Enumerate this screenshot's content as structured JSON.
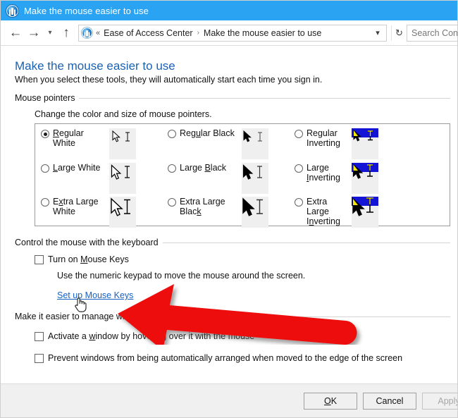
{
  "window": {
    "title": "Make the mouse easier to use",
    "title_icon": "ease-of-access-icon",
    "titlebar_color": "#29a3f2"
  },
  "navbar": {
    "back_icon": "back-arrow-icon",
    "forward_icon": "forward-arrow-icon",
    "history_icon": "chevron-down-icon",
    "up_icon": "up-arrow-icon",
    "address_icon": "ease-of-access-icon",
    "overflow_chevrons": "«",
    "breadcrumb": [
      {
        "label": "Ease of Access Center"
      },
      {
        "label": "Make the mouse easier to use"
      }
    ],
    "breadcrumb_separator": "›",
    "dropdown_icon": "chevron-down-icon",
    "refresh_icon": "refresh-icon",
    "refresh_glyph": "↻",
    "search_placeholder": "Search Contr"
  },
  "page": {
    "title": "Make the mouse easier to use",
    "title_color": "#1b61b0",
    "subtitle": "When you select these tools, they will automatically start each time you sign in."
  },
  "sections": {
    "mouse_pointers": {
      "heading": "Mouse pointers",
      "hint": "Change the color and size of mouse pointers.",
      "options": [
        {
          "id": "regular-white",
          "line1": "Regular",
          "line2": "White",
          "accel": "R",
          "selected": true,
          "style": "white"
        },
        {
          "id": "large-white",
          "line1": "Large White",
          "line2": "",
          "accel": "L",
          "selected": false,
          "style": "white"
        },
        {
          "id": "extra-large-white",
          "line1": "Extra Large",
          "line2": "White",
          "accel": "x",
          "selected": false,
          "style": "white"
        },
        {
          "id": "regular-black",
          "line1": "Regular Black",
          "line2": "",
          "accel": "u",
          "selected": false,
          "style": "black"
        },
        {
          "id": "large-black",
          "line1": "Large Black",
          "line2": "",
          "accel": "B",
          "selected": false,
          "style": "black"
        },
        {
          "id": "extra-large-black",
          "line1": "Extra Large",
          "line2": "Black",
          "accel": "k",
          "selected": false,
          "style": "black"
        },
        {
          "id": "regular-inverting",
          "line1": "Regular",
          "line2": "Inverting",
          "accel": "",
          "selected": false,
          "style": "inverting"
        },
        {
          "id": "large-inverting",
          "line1": "Large",
          "line2": "Inverting",
          "accel": "I",
          "selected": false,
          "style": "inverting"
        },
        {
          "id": "extra-large-inverting",
          "line1": "Extra Large",
          "line2": "Inverting",
          "accel": "n",
          "selected": false,
          "style": "inverting"
        }
      ]
    },
    "keyboard_control": {
      "heading": "Control the mouse with the keyboard",
      "checkbox_label": "Turn on Mouse Keys",
      "checkbox_checked": false,
      "description": "Use the numeric keypad to move the mouse around the screen.",
      "link_label": "Set up Mouse Keys",
      "link_color": "#1661c4"
    },
    "manage_windows": {
      "heading": "Make it easier to manage windows",
      "checkboxes": [
        {
          "id": "activate-window-hover",
          "label": "Activate a window by hovering over it with the mouse",
          "checked": false
        },
        {
          "id": "prevent-auto-arrange",
          "label": "Prevent windows from being automatically arranged when moved to the edge of the screen",
          "checked": false
        }
      ]
    }
  },
  "footer": {
    "ok_label": "OK",
    "cancel_label": "Cancel",
    "apply_label": "Apply",
    "apply_disabled": true
  },
  "annotation": {
    "arrow_color": "#ee1111",
    "arrow_name": "red-callout-arrow",
    "cursor_name": "hand-pointer-cursor"
  }
}
